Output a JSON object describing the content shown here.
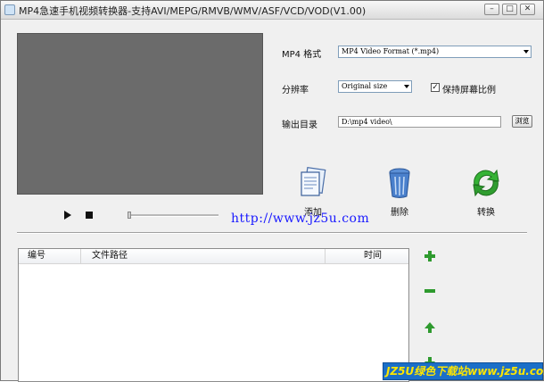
{
  "window": {
    "title": "MP4急速手机视频转换器-支持AVI/MEPG/RMVB/WMV/ASF/VCD/VOD(V1.00)",
    "buttons": {
      "minimize": "–",
      "maximize": "□",
      "close": "✕"
    }
  },
  "settings": {
    "format_label": "MP4 格式",
    "format_value": "MP4 Video Format (*.mp4)",
    "resolution_label": "分辨率",
    "resolution_value": "Original size",
    "keep_ratio_label": "保持屏幕比例",
    "keep_ratio_checked": true,
    "output_label": "输出目录",
    "output_value": "D:\\mp4 video\\",
    "browse_label": "浏览"
  },
  "actions": {
    "add_label": "添加",
    "delete_label": "删除",
    "convert_label": "转换"
  },
  "watermark_url": "http://www.jz5u.com",
  "file_list": {
    "columns": [
      "编号",
      "文件路径",
      "时间"
    ],
    "rows": []
  },
  "side_buttons": [
    "add-item",
    "remove-item",
    "move-up",
    "move-down"
  ],
  "footer_watermark": "JZ5U绿色下载站www.jz5u.com",
  "colors": {
    "video_bg": "#6b6b6b",
    "side_green": "#2e9a2e",
    "watermark_bg": "#1b6fc8",
    "watermark_text": "#ffe600",
    "url_blue": "#1a1aff"
  }
}
